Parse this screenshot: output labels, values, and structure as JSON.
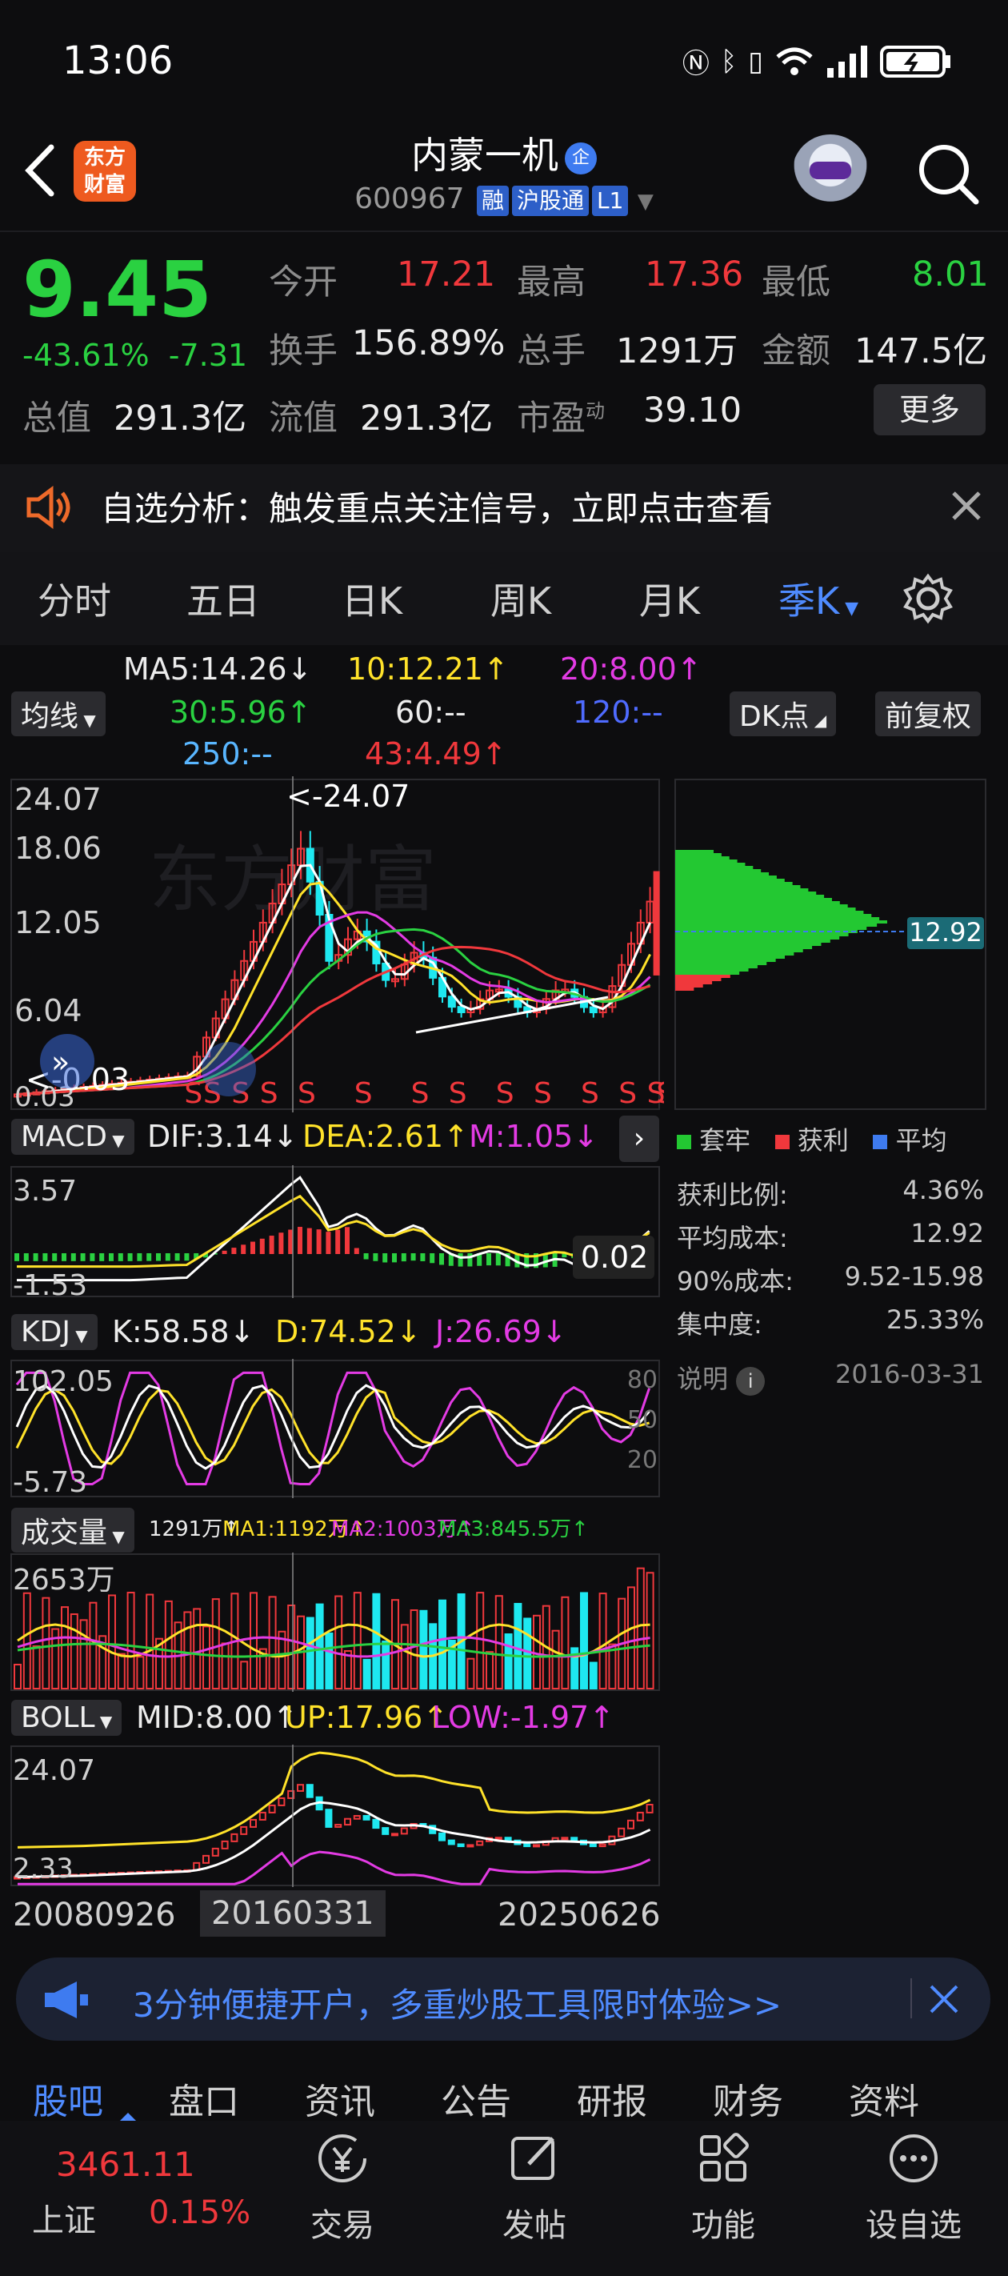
{
  "status": {
    "time": "13:06"
  },
  "header": {
    "brand": "东方\n财富",
    "name": "内蒙一机",
    "name_badge": "企",
    "code": "600967",
    "tags": [
      "融",
      "沪股通",
      "L1"
    ]
  },
  "quote": {
    "price": "9.45",
    "change_pct": "-43.61%",
    "change": "-7.31",
    "open_label": "今开",
    "open": "17.21",
    "high_label": "最高",
    "high": "17.36",
    "low_label": "最低",
    "low": "8.01",
    "turnover_label": "换手",
    "turnover": "156.89%",
    "volume_label": "总手",
    "volume": "1291万",
    "amount_label": "金额",
    "amount": "147.5亿",
    "mcap_label": "总值",
    "mcap": "291.3亿",
    "float_label": "流值",
    "float_mcap": "291.3亿",
    "pe_label": "市盈",
    "pe_sup": "动",
    "pe": "39.10",
    "more": "更多"
  },
  "notice": {
    "text": "自选分析：触发重点关注信号，立即点击查看"
  },
  "tabs": [
    {
      "label": "分时"
    },
    {
      "label": "五日"
    },
    {
      "label": "日K"
    },
    {
      "label": "周K"
    },
    {
      "label": "月K"
    },
    {
      "label": "季K"
    }
  ],
  "ma": {
    "selector": "均线",
    "ma5": "MA5:14.26↓",
    "ma10": "10:12.21↑",
    "ma20": "20:8.00↑",
    "ma30": "30:5.96↑",
    "ma60": "60:--",
    "ma120": "120:--",
    "ma250": "250:--",
    "ma43": "43:4.49↑",
    "dk": "DK点",
    "adjust": "前复权"
  },
  "kline": {
    "y_labels": [
      "24.07",
      "18.06",
      "12.05",
      "6.04",
      "0.03"
    ],
    "max_marker": "<-24.07",
    "min_marker": "<-0.03",
    "s_mark": "S"
  },
  "chip": {
    "price_tag": "12.92",
    "legend": [
      "套牢",
      "获利",
      "平均"
    ],
    "rows": [
      {
        "label": "获利比例:",
        "value": "4.36%"
      },
      {
        "label": "平均成本:",
        "value": "12.92"
      },
      {
        "label": "90%成本:",
        "value": "9.52-15.98"
      },
      {
        "label": "集中度:",
        "value": "25.33%"
      }
    ],
    "note": "说明",
    "date": "2016-03-31"
  },
  "macd": {
    "selector": "MACD",
    "dif": "DIF:3.14↓",
    "dea": "DEA:2.61↑",
    "m": "M:1.05↓",
    "y_top": "3.57",
    "y_bottom": "-1.53",
    "current": "0.02"
  },
  "kdj": {
    "selector": "KDJ",
    "k": "K:58.58↓",
    "d": "D:74.52↓",
    "j": "J:26.69↓",
    "y_top": "102.05",
    "y_bottom": "-5.73",
    "levels": [
      "80",
      "50",
      "20"
    ]
  },
  "vol": {
    "selector": "成交量",
    "v": "1291万↑",
    "ma1": "MA1:1192万↑",
    "ma2": "MA2:1003万↑",
    "ma3": "MA3:845.5万↑",
    "y_top": "2653万"
  },
  "boll": {
    "selector": "BOLL",
    "mid": "MID:8.00↑",
    "up": "UP:17.96↑",
    "low": "LOW:-1.97↑",
    "y_top": "24.07",
    "y_bottom": "2.33"
  },
  "dates": [
    "20080926",
    "20160331",
    "20250626"
  ],
  "ad": {
    "text": "3分钟便捷开户，多重炒股工具限时体验>>"
  },
  "bottom_tabs": [
    {
      "label": "股吧"
    },
    {
      "label": "盘口"
    },
    {
      "label": "资讯"
    },
    {
      "label": "公告"
    },
    {
      "label": "研报"
    },
    {
      "label": "财务"
    },
    {
      "label": "资料"
    }
  ],
  "index": {
    "value": "3461.11",
    "name": "上证",
    "pct": "0.15%"
  },
  "nav": [
    {
      "label": "交易"
    },
    {
      "label": "发帖"
    },
    {
      "label": "功能"
    },
    {
      "label": "设自选"
    }
  ],
  "colors": {
    "up": "#f0383c",
    "down": "#2ad141",
    "accent": "#4f8bff",
    "background": "#0d0d0f"
  }
}
